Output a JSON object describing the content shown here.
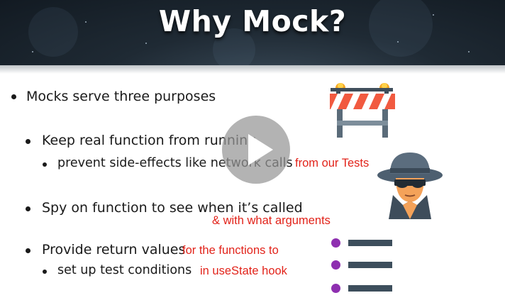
{
  "slide": {
    "title": "Why Mock?",
    "bullets": {
      "b1": "Mocks serve three purposes",
      "b2": "Keep real function from running",
      "b2a": "prevent side-effects like network calls",
      "b3": "Spy on function to see when it’s called",
      "b4": "Provide return values",
      "b4a": "set up test conditions"
    },
    "annotations": {
      "a1": "from our Tests",
      "a2": "& with what arguments",
      "a3": "for the functions to",
      "a4": "in useState hook"
    }
  },
  "icons": {
    "barrier": "road-barrier-icon",
    "spy": "spy-icon",
    "list": "list-icon",
    "play": "play-icon"
  },
  "colors": {
    "header_bg": "#1f2a34",
    "annotation_red": "#e2231a",
    "barrier_orange": "#f15a40",
    "list_purple": "#8e2fb0",
    "spy_hat": "#56687a"
  }
}
